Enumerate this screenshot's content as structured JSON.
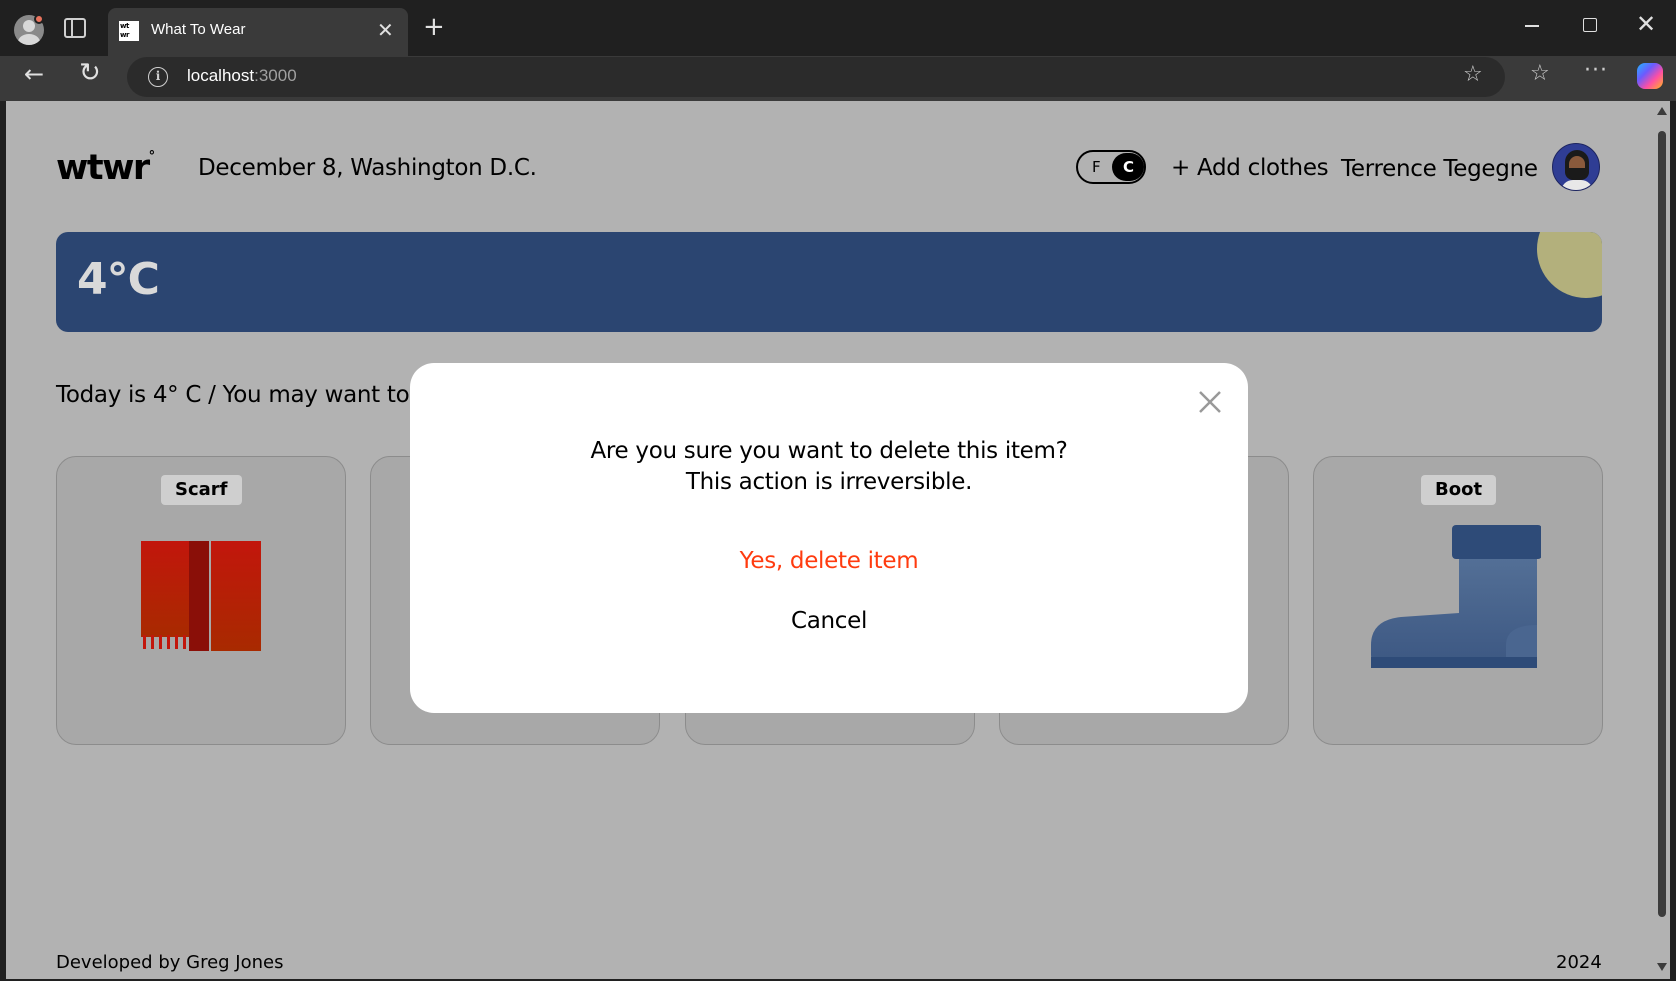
{
  "browser": {
    "tab_title": "What To Wear",
    "favicon_text": "wt wr",
    "url_host": "localhost",
    "url_port": ":3000"
  },
  "header": {
    "logo": "wtwr",
    "logo_degree": "°",
    "date_location": "December 8, Washington D.C.",
    "unit_f": "F",
    "unit_c": "C",
    "add_clothes": "+ Add clothes",
    "username": "Terrence Tegegne"
  },
  "weather": {
    "temperature": "4°C",
    "card_color": "#2b4571",
    "sun_color": "#b3b07c"
  },
  "main": {
    "recommendation": "Today is 4° C / You may want to w"
  },
  "cards": [
    {
      "label": "Scarf",
      "icon": "scarf-icon"
    },
    {
      "label": "",
      "icon": ""
    },
    {
      "label": "",
      "icon": ""
    },
    {
      "label": "",
      "icon": ""
    },
    {
      "label": "Boot",
      "icon": "boot-icon"
    }
  ],
  "footer": {
    "developer": "Developed by Greg Jones",
    "year": "2024"
  },
  "modal": {
    "line1": "Are you sure you want to delete this item?",
    "line2": "This action is irreversible.",
    "confirm_label": "Yes, delete item",
    "cancel_label": "Cancel",
    "confirm_color": "#ff3b0f"
  }
}
